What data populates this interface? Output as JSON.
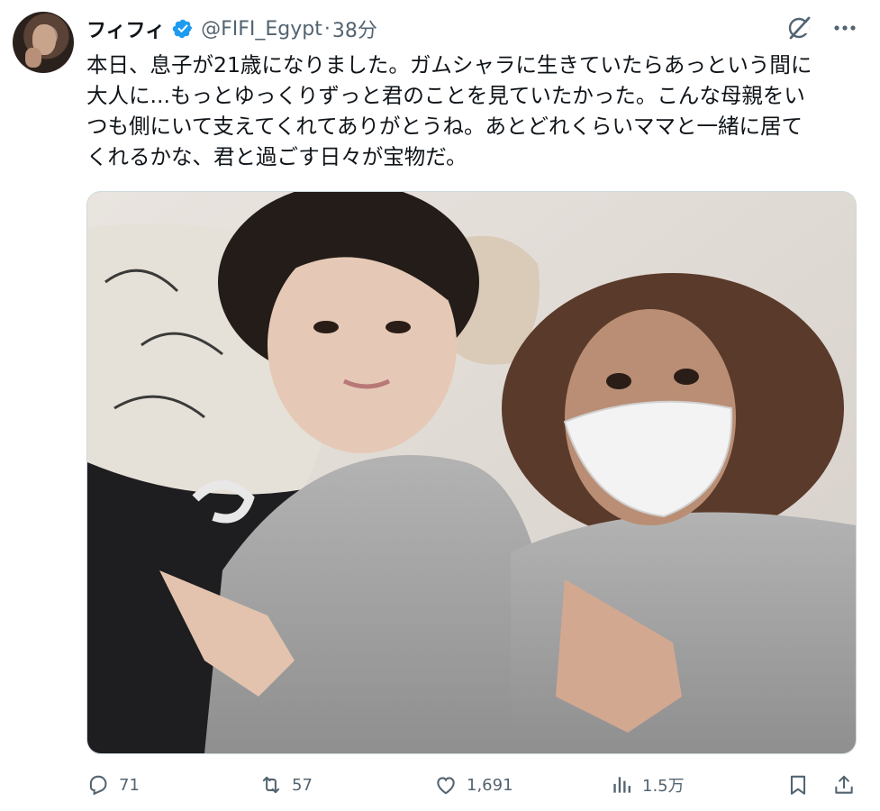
{
  "tweet": {
    "author_name": "フィフィ",
    "handle": "@FIFI_Egypt",
    "separator": "·",
    "time": "38分",
    "text_lines": [
      "本日、息子が21歳になりました。ガムシャラに生きていたらあっという間に",
      "大人に...もっとゆっくりずっと君のことを見ていたかった。こんな母親をい",
      "つも側にいて支えてくれてありがとうね。あとどれくらいママと一緒に居て",
      "くれるかな、君と過ごす日々が宝物だ。"
    ]
  },
  "actions": {
    "replies": "71",
    "reposts": "57",
    "likes": "1,691",
    "views": "1.5万"
  },
  "icons": {
    "verified": "verified-badge-icon",
    "grok": "grok-icon",
    "more": "more-options-icon",
    "reply": "reply-icon",
    "repost": "repost-icon",
    "like": "heart-icon",
    "views": "views-chart-icon",
    "bookmark": "bookmark-icon",
    "share": "share-icon"
  },
  "colors": {
    "verified": "#1d9bf0",
    "secondary_text": "#536471",
    "primary_text": "#0f1419"
  }
}
